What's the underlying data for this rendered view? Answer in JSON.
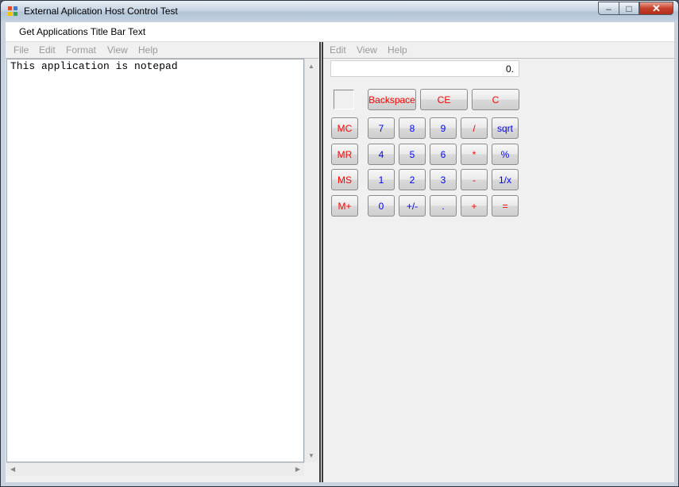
{
  "window": {
    "title": "External Aplication Host Control Test",
    "controls": {
      "minimize": "–",
      "maximize": "□",
      "close": "✕"
    }
  },
  "menubar": {
    "item": "Get Applications Title Bar Text"
  },
  "notepad": {
    "menu": [
      "File",
      "Edit",
      "Format",
      "View",
      "Help"
    ],
    "text": "This application is notepad"
  },
  "calculator": {
    "menu": [
      "Edit",
      "View",
      "Help"
    ],
    "display": "0.",
    "top_buttons": [
      "Backspace",
      "CE",
      "C"
    ],
    "memory_buttons": [
      "MC",
      "MR",
      "MS",
      "M+"
    ],
    "keypad": [
      [
        "7",
        "8",
        "9",
        "/",
        "sqrt"
      ],
      [
        "4",
        "5",
        "6",
        "*",
        "%"
      ],
      [
        "1",
        "2",
        "3",
        "-",
        "1/x"
      ],
      [
        "0",
        "+/-",
        ".",
        "+",
        "="
      ]
    ]
  },
  "colors": {
    "operator": "#ff0000",
    "digit": "#0000ff",
    "disabled_menu": "#9a9a9a"
  }
}
